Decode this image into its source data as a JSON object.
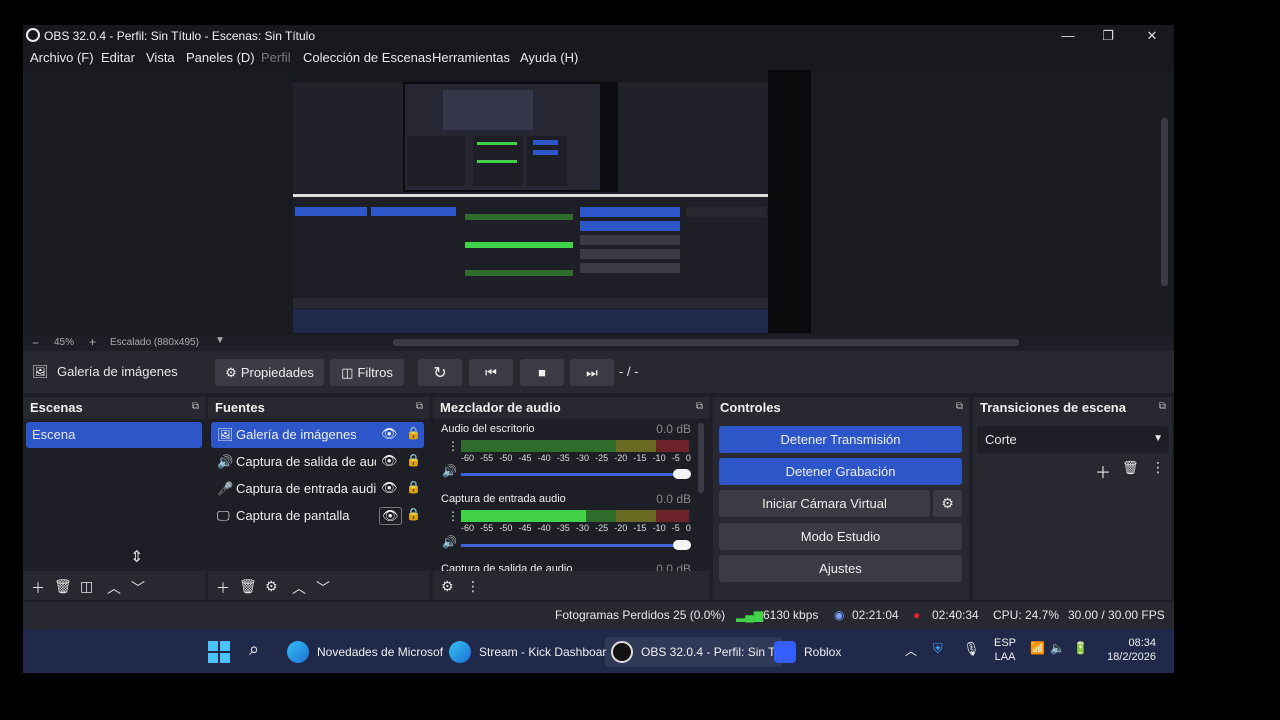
{
  "window": {
    "title": "OBS 32.0.4 - Perfil: Sin Título - Escenas: Sin Título",
    "controls": [
      "—",
      "❐",
      "✕"
    ]
  },
  "menu": {
    "items": [
      "Archivo (F)",
      "Editar",
      "Vista",
      "Paneles (D)",
      "Perfil",
      "Colección de Escenas",
      "Herramientas",
      "Ayuda (H)"
    ]
  },
  "zoom": {
    "minus": "−",
    "level": "45%",
    "plus": "+",
    "scale_label": "Escalado (880x495)"
  },
  "source_toolbar": {
    "selected_source": "Galería de imágenes",
    "properties": "Propiedades",
    "filters": "Filtros",
    "time": "- / -"
  },
  "scenes": {
    "title": "Escenas",
    "items": [
      "Escena"
    ]
  },
  "sources": {
    "title": "Fuentes",
    "items": [
      {
        "label": "Galería de imágenes",
        "icon": "image-icon",
        "selected": true
      },
      {
        "label": "Captura de salida de audio",
        "icon": "speaker-icon",
        "selected": false
      },
      {
        "label": "Captura de entrada audio",
        "icon": "mic-icon",
        "selected": false
      },
      {
        "label": "Captura de pantalla",
        "icon": "monitor-icon",
        "selected": false
      }
    ]
  },
  "mixer": {
    "title": "Mezclador de audio",
    "ticks": [
      "-60",
      "-55",
      "-50",
      "-45",
      "-40",
      "-35",
      "-30",
      "-25",
      "-20",
      "-15",
      "-10",
      "-5",
      "0"
    ],
    "channels": [
      {
        "name": "Audio del escritorio",
        "db": "0.0 dB",
        "level": 0
      },
      {
        "name": "Captura de entrada audio",
        "db": "0.0 dB",
        "level": 0.55
      },
      {
        "name": "Captura de salida de audio",
        "db": "0.0 dB",
        "level": 0
      }
    ]
  },
  "controls": {
    "title": "Controles",
    "stop_stream": "Detener Transmisión",
    "stop_record": "Detener Grabación",
    "virtual_cam": "Iniciar Cámara Virtual",
    "studio_mode": "Modo Estudio",
    "settings": "Ajustes"
  },
  "transitions": {
    "title": "Transiciones de escena",
    "selected": "Corte"
  },
  "status": {
    "dropped_frames": "Fotogramas Perdidos 25 (0.0%)",
    "bitrate": "6130 kbps",
    "stream_time": "02:21:04",
    "record_time": "02:40:34",
    "cpu": "CPU: 24.7%",
    "fps": "30.00 / 30.00 FPS"
  },
  "taskbar": {
    "apps": [
      {
        "label": "Novedades de Microsof"
      },
      {
        "label": "Stream - Kick Dashboar"
      },
      {
        "label": "OBS 32.0.4 - Perfil: Sin T"
      },
      {
        "label": "Roblox"
      }
    ],
    "lang_top": "ESP",
    "lang_bottom": "LAA",
    "time": "08:34",
    "date": "18/2/2026"
  },
  "colors": {
    "accent": "#2d57c8",
    "dock_bg": "#272830",
    "panel_bg": "#1e1f26",
    "record_red": "#e0202a",
    "meter_green": "#41d24a"
  }
}
